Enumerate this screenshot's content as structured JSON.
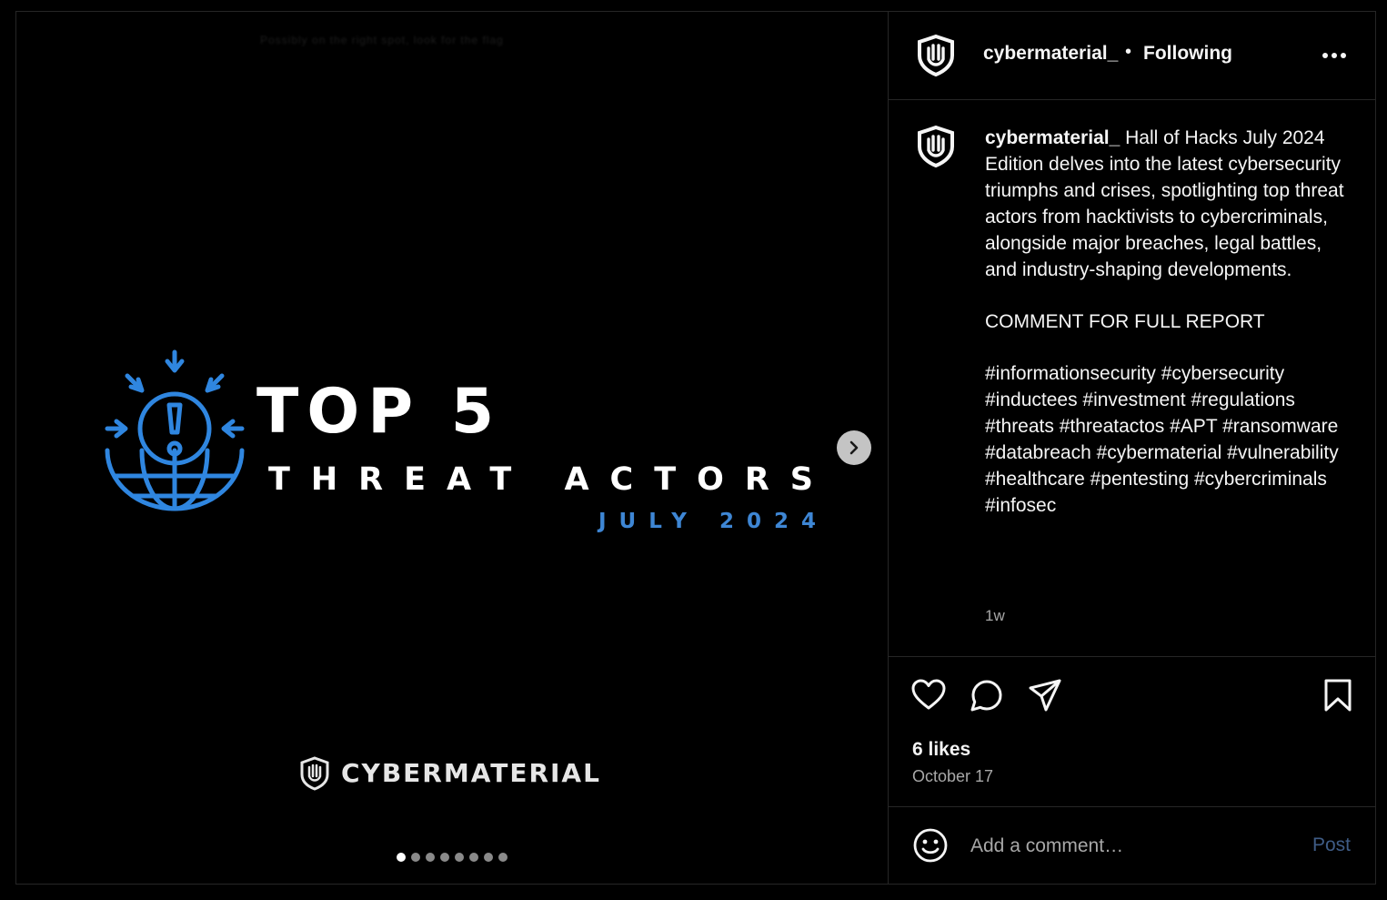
{
  "media": {
    "blurred_caption": "Possibly on the right spot, look for the flag",
    "title": "TOP 5",
    "subtitle": "THREAT ACTORS",
    "date_line": "JULY 2024",
    "brand": "CYBERMATERIAL",
    "accent_color": "#3e86d4",
    "carousel": {
      "total": 8,
      "current": 1
    },
    "next_icon": "chevron-right-icon"
  },
  "header": {
    "username": "cybermaterial_",
    "separator": "•",
    "follow_status": "Following",
    "more_icon": "more-horizontal-icon"
  },
  "caption": {
    "username": "cybermaterial_",
    "text": " Hall of Hacks July 2024 Edition delves into the latest cybersecurity triumphs and crises, spotlighting top threat actors from hacktivists to cybercriminals, alongside major breaches, legal battles, and industry-shaping developments.",
    "cta": "COMMENT FOR FULL REPORT",
    "hashtags": "#informationsecurity #cybersecurity #inductees #investment #regulations #threats #threatactos #APT #ransomware #databreach #cybermaterial #vulnerability #healthcare #pentesting #cybercriminals #infosec",
    "time_ago": "1w"
  },
  "actions": {
    "icons": [
      "heart-icon",
      "comment-icon",
      "share-icon",
      "bookmark-icon"
    ],
    "likes": "6 likes",
    "date": "October 17"
  },
  "comment": {
    "placeholder": "Add a comment…",
    "post_label": "Post",
    "emoji_icon": "emoji-icon"
  }
}
